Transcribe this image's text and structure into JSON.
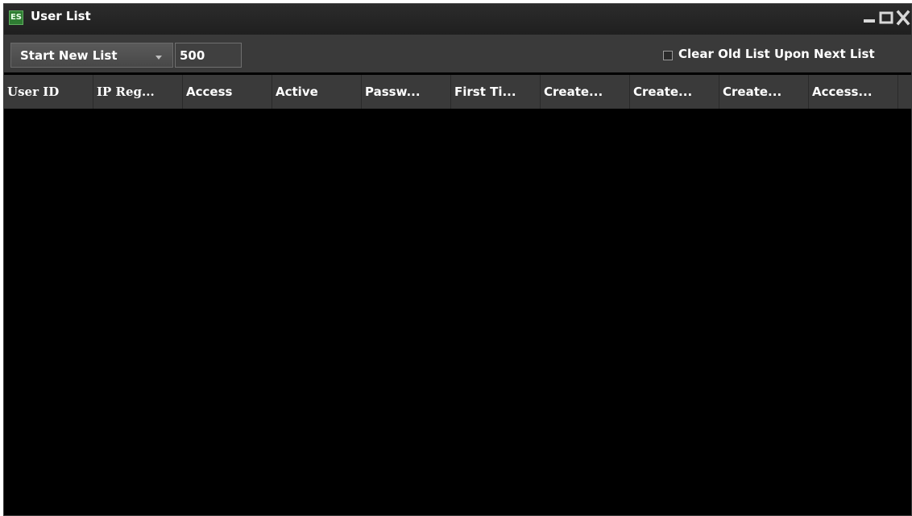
{
  "window": {
    "title": "User List",
    "icon_text": "ES",
    "accent_color": "#2f7d33",
    "controls": [
      "minimize-icon",
      "maximize-icon",
      "close-icon"
    ]
  },
  "toolbar": {
    "dropdown_label": "Start New List",
    "count_value": "500",
    "clear_checkbox_label": "Clear Old List Upon Next List",
    "clear_checked": false
  },
  "table": {
    "columns": [
      "User ID",
      "IP Reg...",
      "Access",
      "Active",
      "Passw...",
      "First Ti...",
      "Create...",
      "Create...",
      "Create...",
      "Access..."
    ],
    "rows": []
  }
}
